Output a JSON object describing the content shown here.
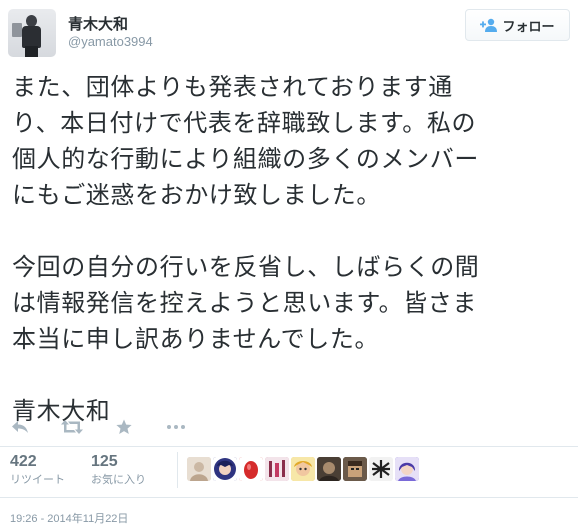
{
  "author": {
    "fullname": "青木大和",
    "username": "@yamato3994"
  },
  "follow_button": {
    "label": "フォロー",
    "icon": "add-person-icon"
  },
  "tweet": {
    "text": "また、団体よりも発表されております通\nり、本日付けで代表を辞職致します。私の\n個人的な行動により組織の多くのメンバー\nにもご迷惑をおかけ致しました。\n\n今回の自分の行いを反省し、しばらくの間\nは情報発信を控えようと思います。皆さま\n本当に申し訳ありませんでした。\n\n青木大和"
  },
  "actions": [
    {
      "name": "reply",
      "icon": "reply-icon"
    },
    {
      "name": "retweet",
      "icon": "retweet-icon"
    },
    {
      "name": "favorite",
      "icon": "star-icon"
    },
    {
      "name": "more",
      "icon": "more-dots-icon"
    }
  ],
  "stats": {
    "retweets": {
      "count": "422",
      "label": "リツイート"
    },
    "favorites": {
      "count": "125",
      "label": "お気に入り"
    }
  },
  "favoriters": [
    {
      "icon": "user-avatar-1",
      "color": "#d9cbbd"
    },
    {
      "icon": "user-avatar-2",
      "color": "#3a3f8f"
    },
    {
      "icon": "user-avatar-3",
      "color": "#d52b2b"
    },
    {
      "icon": "user-avatar-4",
      "color": "#c98aa0"
    },
    {
      "icon": "user-avatar-5",
      "color": "#e8c24a"
    },
    {
      "icon": "user-avatar-6",
      "color": "#5a4a3a"
    },
    {
      "icon": "user-avatar-7",
      "color": "#3b3b3b"
    },
    {
      "icon": "user-avatar-8",
      "color": "#f4f4f4"
    },
    {
      "icon": "user-avatar-9",
      "color": "#6a5acd"
    }
  ],
  "timestamp": "19:26 - 2014年11月22日",
  "colors": {
    "text": "#292f33",
    "muted": "#8899a6",
    "icon": "#aab8c2",
    "border": "#e1e8ed"
  }
}
